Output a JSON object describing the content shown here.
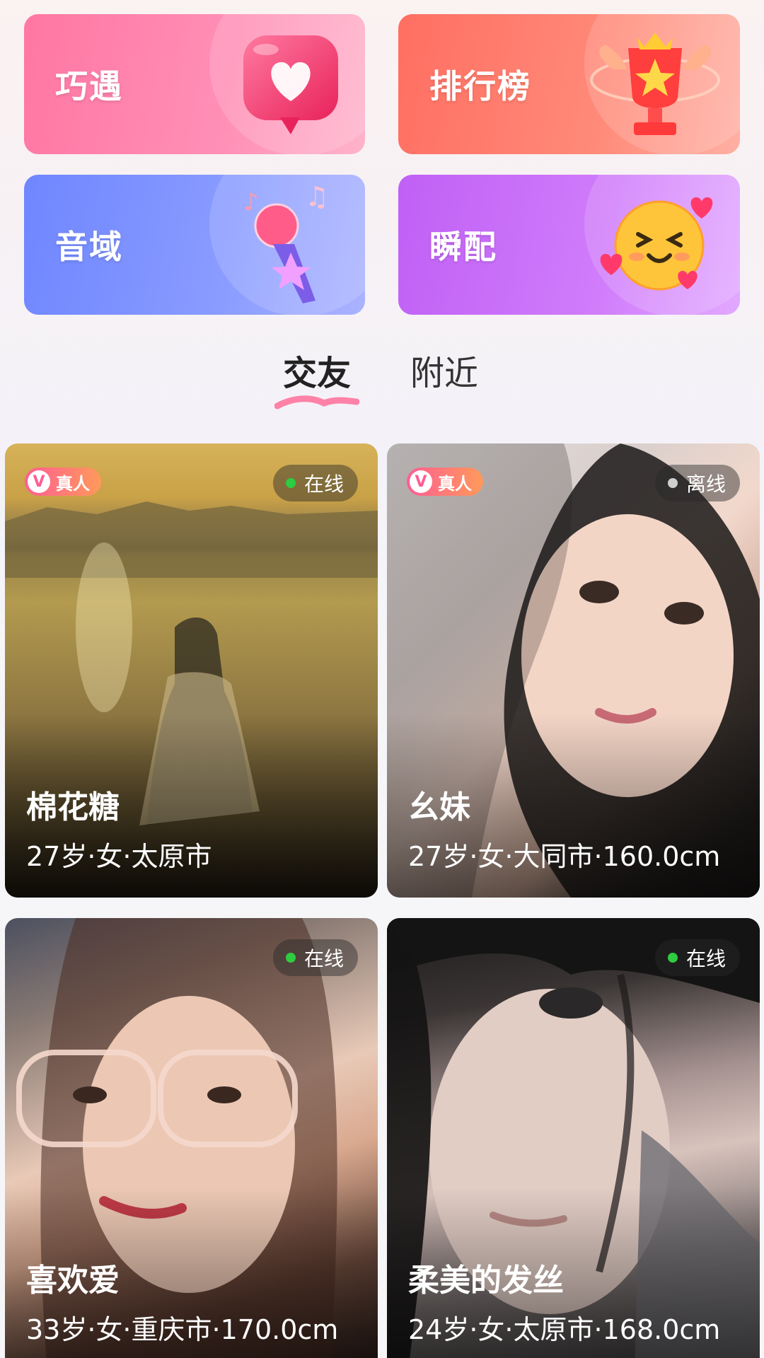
{
  "features": [
    {
      "label": "巧遇",
      "icon": "heart-bubble-icon"
    },
    {
      "label": "排行榜",
      "icon": "trophy-icon"
    },
    {
      "label": "音域",
      "icon": "microphone-icon"
    },
    {
      "label": "瞬配",
      "icon": "smiley-hearts-icon"
    }
  ],
  "tabs": {
    "active": "交友",
    "items": [
      "交友",
      "附近"
    ]
  },
  "colors": {
    "online": "#2ecc40",
    "offline": "#cfcfcf",
    "badge_start": "#ff5d93",
    "badge_end": "#ff9a5a"
  },
  "cards": [
    {
      "name": "棉花糖",
      "info": "27岁·女·太原市",
      "status": "在线",
      "status_type": "online",
      "badge": "真人",
      "badge_v": "V"
    },
    {
      "name": "幺妹",
      "info": "27岁·女·大同市·160.0cm",
      "status": "离线",
      "status_type": "offline",
      "badge": "真人",
      "badge_v": "V"
    },
    {
      "name": "喜欢爱",
      "info": "33岁·女·重庆市·170.0cm",
      "status": "在线",
      "status_type": "online"
    },
    {
      "name": "柔美的发丝",
      "info": "24岁·女·太原市·168.0cm",
      "status": "在线",
      "status_type": "online"
    }
  ]
}
